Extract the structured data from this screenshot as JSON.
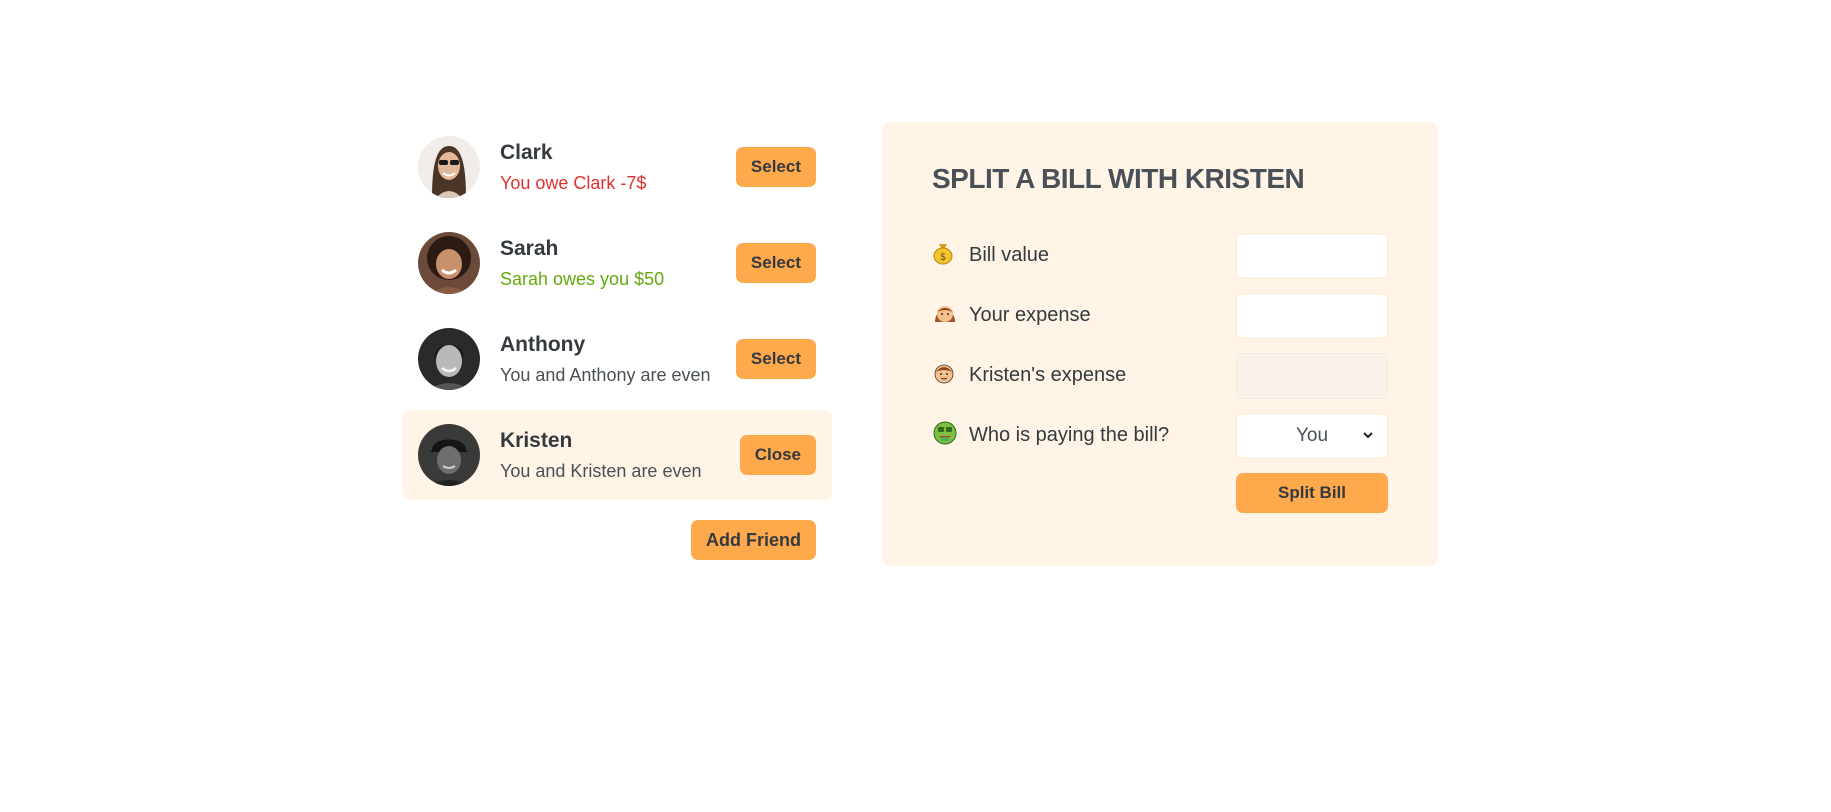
{
  "friends": [
    {
      "name": "Clark",
      "status": "You owe Clark -7$",
      "status_color": "#e03131",
      "button": "Select",
      "selected": false
    },
    {
      "name": "Sarah",
      "status": "Sarah owes you $50",
      "status_color": "#66a80f",
      "button": "Select",
      "selected": false
    },
    {
      "name": "Anthony",
      "status": "You and Anthony are even",
      "status_color": "#495057",
      "button": "Select",
      "selected": false
    },
    {
      "name": "Kristen",
      "status": "You and Kristen are even",
      "status_color": "#495057",
      "button": "Close",
      "selected": true
    }
  ],
  "add_friend_label": "Add Friend",
  "form": {
    "title": "SPLIT A BILL WITH KRISTEN",
    "bill_value": {
      "icon": "money-bag-icon",
      "label": "Bill value",
      "value": ""
    },
    "your_expense": {
      "icon": "woman-icon",
      "label": "Your expense",
      "value": ""
    },
    "friend_expense": {
      "icon": "boy-icon",
      "label": "Kristen's expense",
      "value": ""
    },
    "payer": {
      "icon": "money-mouth-face-icon",
      "label": "Who is paying the bill?",
      "selected": "You"
    },
    "submit_label": "Split Bill"
  },
  "colors": {
    "accent": "#ffa94d",
    "panel_bg": "#fff4e6",
    "owe_red": "#e03131",
    "owed_green": "#66a80f"
  }
}
